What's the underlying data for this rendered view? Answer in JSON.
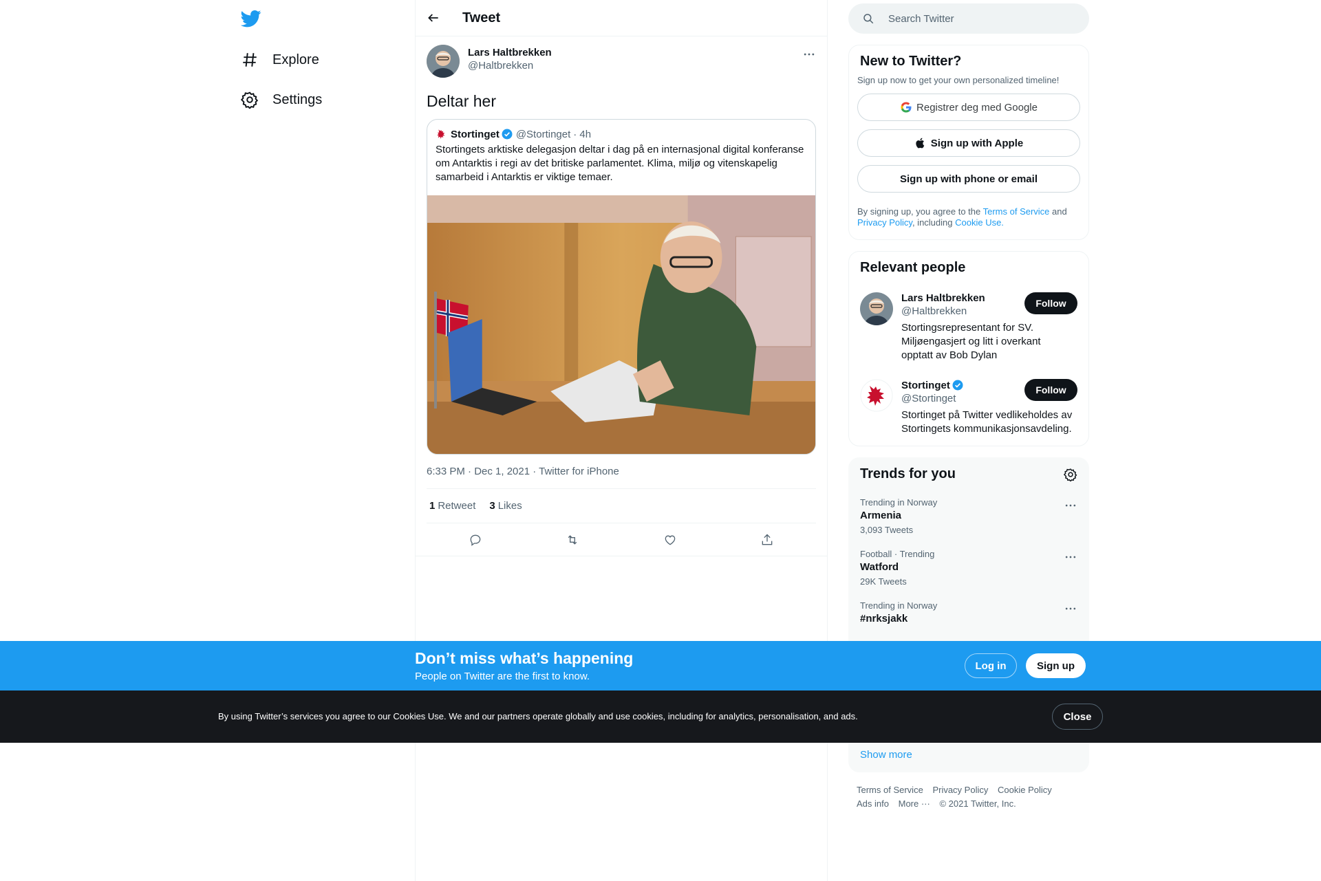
{
  "nav": {
    "items": [
      {
        "label": "Explore",
        "icon": "hashtag-icon"
      },
      {
        "label": "Settings",
        "icon": "gear-icon"
      }
    ]
  },
  "header": {
    "title": "Tweet"
  },
  "tweet": {
    "author_name": "Lars Haltbrekken",
    "author_handle": "@Haltbrekken",
    "text": "Deltar her",
    "quote": {
      "name": "Stortinget",
      "handle": "@Stortinget",
      "time": "· 4h",
      "text": "Stortingets arktiske delegasjon deltar i dag på en internasjonal digital konferanse om Antarktis i regi av det britiske parlamentet. Klima, miljø og vitenskapelig samarbeid i Antarktis er viktige temaer."
    },
    "timestamp": "6:33 PM · Dec 1, 2021 · Twitter for iPhone",
    "retweets_count": "1",
    "retweets_label": "Retweet",
    "likes_count": "3",
    "likes_label": "Likes"
  },
  "search": {
    "placeholder": "Search Twitter"
  },
  "signup_card": {
    "title": "New to Twitter?",
    "subtitle": "Sign up now to get your own personalized timeline!",
    "google_label": "Registrer deg med Google",
    "apple_label": "Sign up with Apple",
    "phone_label": "Sign up with phone or email",
    "legal_prefix": "By signing up, you agree to the ",
    "terms": "Terms of Service",
    "and": " and ",
    "privacy": "Privacy Policy",
    "including": ", including ",
    "cookie": "Cookie Use."
  },
  "relevant": {
    "title": "Relevant people",
    "people": [
      {
        "name": "Lars Haltbrekken",
        "handle": "@Haltbrekken",
        "bio": "Stortingsrepresentant for SV. Miljøengasjert og litt i overkant opptatt av Bob Dylan",
        "follow": "Follow"
      },
      {
        "name": "Stortinget",
        "handle": "@Stortinget",
        "bio": "Stortinget på Twitter vedlikeholdes av Stortingets kommunikasjonsavdeling.",
        "follow": "Follow"
      }
    ]
  },
  "trends": {
    "title": "Trends for you",
    "items": [
      {
        "meta": "Trending in Norway",
        "name": "Armenia",
        "count": "3,093 Tweets"
      },
      {
        "meta": "Football · Trending",
        "name": "Watford",
        "count": "29K Tweets"
      },
      {
        "meta": "Trending in Norway",
        "name": "#nrksjakk",
        "count": ""
      }
    ],
    "show_more": "Show more"
  },
  "footer": {
    "links": [
      "Terms of Service",
      "Privacy Policy",
      "Cookie Policy",
      "Ads info",
      "More ···",
      "© 2021 Twitter, Inc."
    ]
  },
  "signup_bar": {
    "heading": "Don’t miss what’s happening",
    "sub": "People on Twitter are the first to know.",
    "login": "Log in",
    "signup": "Sign up"
  },
  "cookie_bar": {
    "text": "By using Twitter’s services you agree to our Cookies Use. We and our partners operate globally and use cookies, including for analytics, personalisation, and ads.",
    "close": "Close"
  },
  "colors": {
    "accent": "#1d9bf0",
    "text": "#0f1419",
    "secondary": "#536471",
    "cookie_bg": "#16181c"
  }
}
